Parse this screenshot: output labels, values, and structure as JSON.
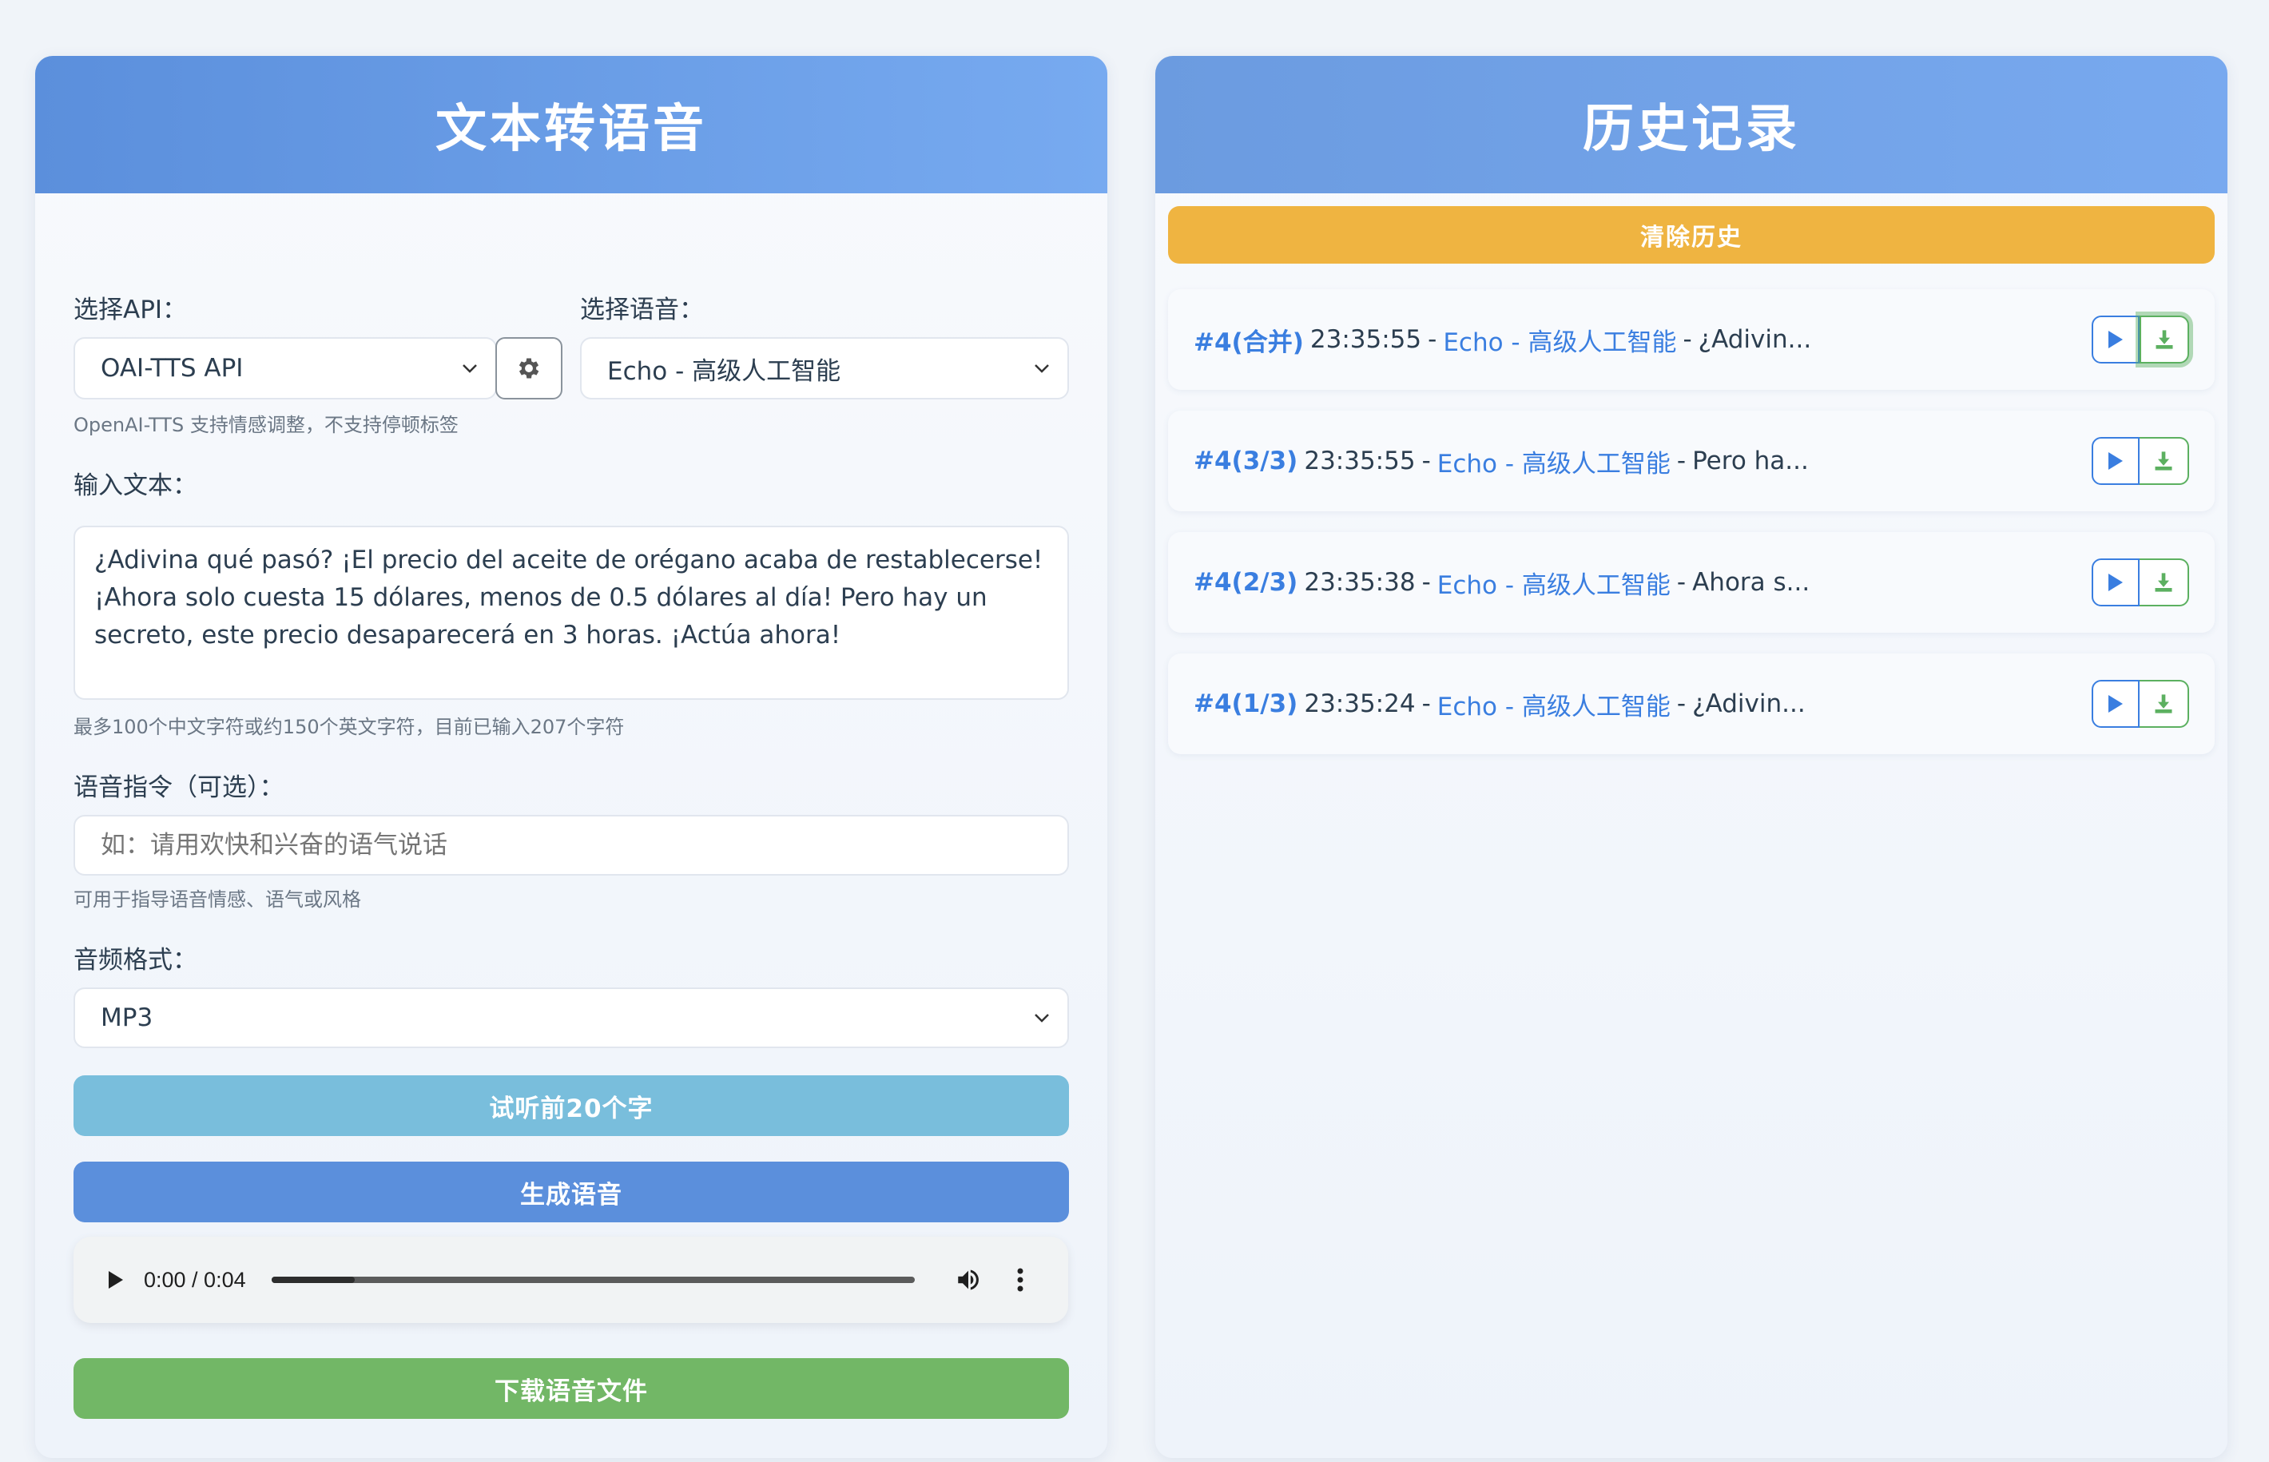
{
  "left": {
    "title": "文本转语音",
    "api": {
      "label": "选择API：",
      "value": "OAI-TTS API",
      "hint": "OpenAI-TTS 支持情感调整，不支持停顿标签"
    },
    "voice": {
      "label": "选择语音：",
      "value": "Echo - 高级人工智能"
    },
    "text": {
      "label": "输入文本：",
      "value": "¿Adivina qué pasó? ¡El precio del aceite de orégano acaba de restablecerse! ¡Ahora solo cuesta 15 dólares, menos de 0.5 dólares al día! Pero hay un secreto, este precio desaparecerá en 3 horas. ¡Actúa ahora!",
      "hint": "最多100个中文字符或约150个英文字符，目前已输入207个字符"
    },
    "instruction": {
      "label": "语音指令（可选）：",
      "placeholder": "如：请用欢快和兴奋的语气说话",
      "hint": "可用于指导语音情感、语气或风格"
    },
    "format": {
      "label": "音频格式：",
      "value": "MP3"
    },
    "preview_button": "试听前20个字",
    "generate_button": "生成语音",
    "player": {
      "time": "0:00 / 0:04",
      "buffered_fraction": 0.13
    },
    "download_button": "下载语音文件"
  },
  "right": {
    "title": "历史记录",
    "clear_button": "清除历史",
    "items": [
      {
        "tag": "#4(合并)",
        "time": "23:35:55",
        "voice": "Echo - 高级人工智能",
        "text": "¿Adivin..."
      },
      {
        "tag": "#4(3/3)",
        "time": "23:35:55",
        "voice": "Echo - 高级人工智能",
        "text": "Pero ha..."
      },
      {
        "tag": "#4(2/3)",
        "time": "23:35:38",
        "voice": "Echo - 高级人工智能",
        "text": "Ahora s..."
      },
      {
        "tag": "#4(1/3)",
        "time": "23:35:24",
        "voice": "Echo - 高级人工智能",
        "text": "¿Adivin..."
      }
    ]
  },
  "icons": {
    "select_arrow": "chevron-down-icon",
    "settings": "gear-icon",
    "play": "play-icon",
    "download": "download-icon",
    "volume": "volume-icon",
    "more": "more-vertical-icon"
  },
  "colors": {
    "header": "#6b9be0",
    "preview": "#79bedc",
    "generate": "#5b8fdc",
    "download": "#72b766",
    "clear": "#efb441",
    "link": "#3a7ee0"
  }
}
